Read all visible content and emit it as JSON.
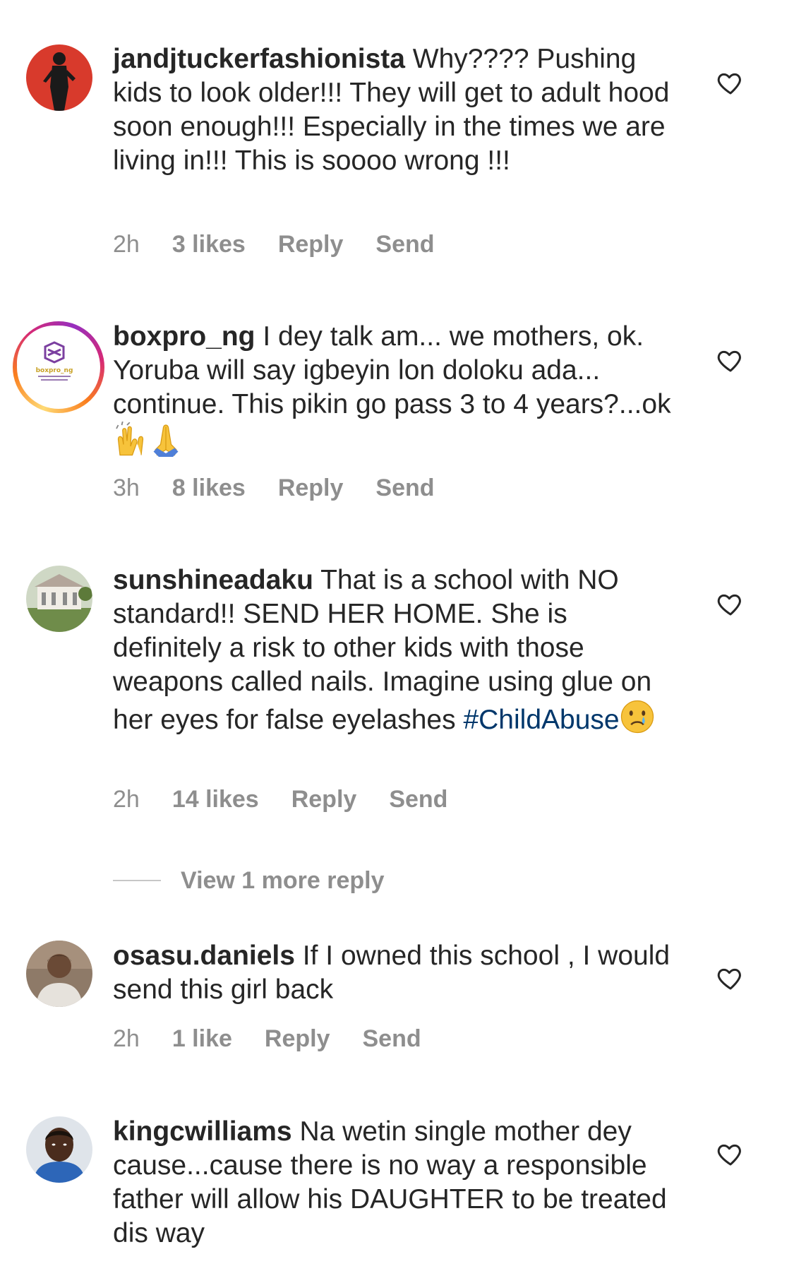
{
  "comments": [
    {
      "username": "jandjtuckerfashionista",
      "text": "Why???? Pushing kids to look older!!! They will get to adult hood soon enough!!! Especially in the times we are living in!!! This is soooo wrong !!!",
      "time": "2h",
      "likes": "3 likes",
      "reply": "Reply",
      "send": "Send"
    },
    {
      "username": "boxpro_ng",
      "text": "I dey talk am... we mothers, ok. Yoruba will say igbeyin lon doloku ada... continue. This pikin go pass 3 to 4 years?...ok",
      "emojis": [
        "raising-hands",
        "folded-hands"
      ],
      "time": "3h",
      "likes": "8 likes",
      "reply": "Reply",
      "send": "Send",
      "avatar_label": "boxpro_ng"
    },
    {
      "username": "sunshineadaku",
      "text": "That is a school with NO standard!! SEND HER HOME. She is definitely a risk to other kids with those weapons called nails. Imagine using glue on her eyes for false eyelashes",
      "hashtag": "#ChildAbuse",
      "emojis": [
        "crying-face"
      ],
      "time": "2h",
      "likes": "14 likes",
      "reply": "Reply",
      "send": "Send"
    },
    {
      "username": "osasu.daniels",
      "text": "If I owned this school , I would send this girl back",
      "time": "2h",
      "likes": "1 like",
      "reply": "Reply",
      "send": "Send"
    },
    {
      "username": "kingcwilliams",
      "text": "Na wetin single mother dey cause...cause there is no way a responsible father will allow his DAUGHTER to be treated dis way"
    }
  ],
  "view_more_replies": "View 1 more reply",
  "icons": {
    "heart": "heart-outline-icon"
  },
  "colors": {
    "text": "#262626",
    "muted": "#8e8e8e",
    "hashtag": "#00376b"
  }
}
